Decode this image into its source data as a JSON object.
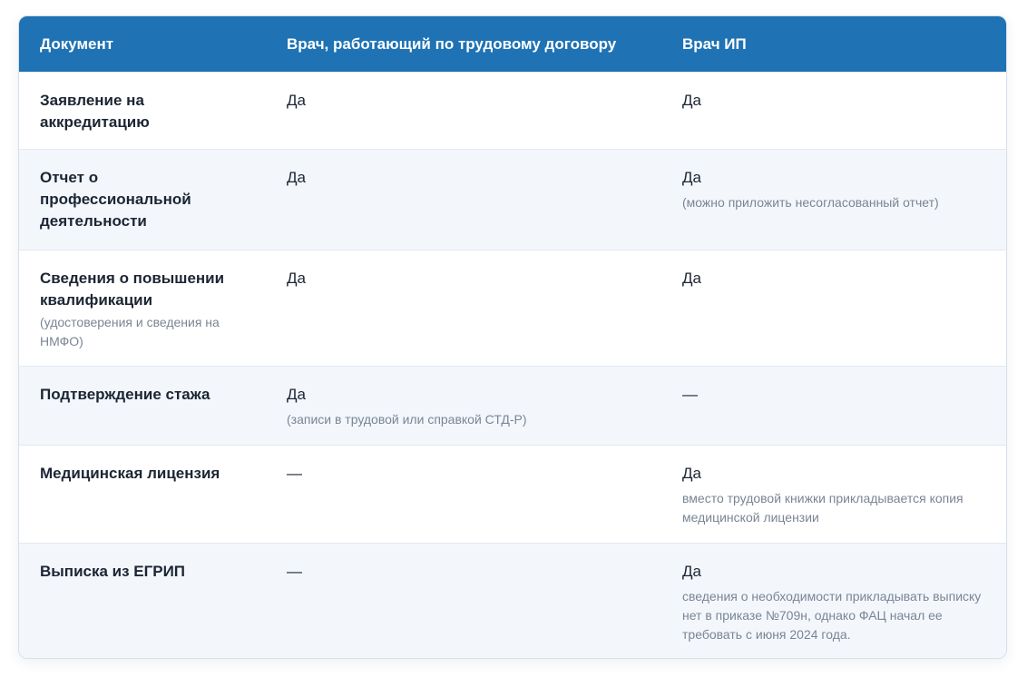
{
  "table": {
    "headers": [
      "Документ",
      "Врач, работающий по трудовому договору",
      "Врач ИП"
    ],
    "rows": [
      {
        "document": "Заявление на аккредитацию",
        "document_note": "",
        "employee": "Да",
        "employee_note": "",
        "ip": "Да",
        "ip_note": ""
      },
      {
        "document": "Отчет о профессиональной деятельности",
        "document_note": "",
        "employee": "Да",
        "employee_note": "",
        "ip": "Да",
        "ip_note": "(можно приложить несогласованный отчет)"
      },
      {
        "document": "Сведения о повышении квалификации",
        "document_note": "(удостоверения и сведения на НМФО)",
        "employee": "Да",
        "employee_note": "",
        "ip": "Да",
        "ip_note": ""
      },
      {
        "document": "Подтверждение стажа",
        "document_note": "",
        "employee": "Да",
        "employee_note": "(записи в трудовой или справкой СТД-Р)",
        "ip": "—",
        "ip_note": ""
      },
      {
        "document": "Медицинская лицензия",
        "document_note": "",
        "employee": "—",
        "employee_note": "",
        "ip": "Да",
        "ip_note": "вместо трудовой книжки прикладывается копия медицинской лицензии"
      },
      {
        "document": "Выписка из ЕГРИП",
        "document_note": "",
        "employee": "—",
        "employee_note": "",
        "ip": "Да",
        "ip_note": "сведения о необходимости прикладывать выписку нет в приказе №709н, однако ФАЦ начал ее требовать с июня 2024 года."
      }
    ]
  }
}
